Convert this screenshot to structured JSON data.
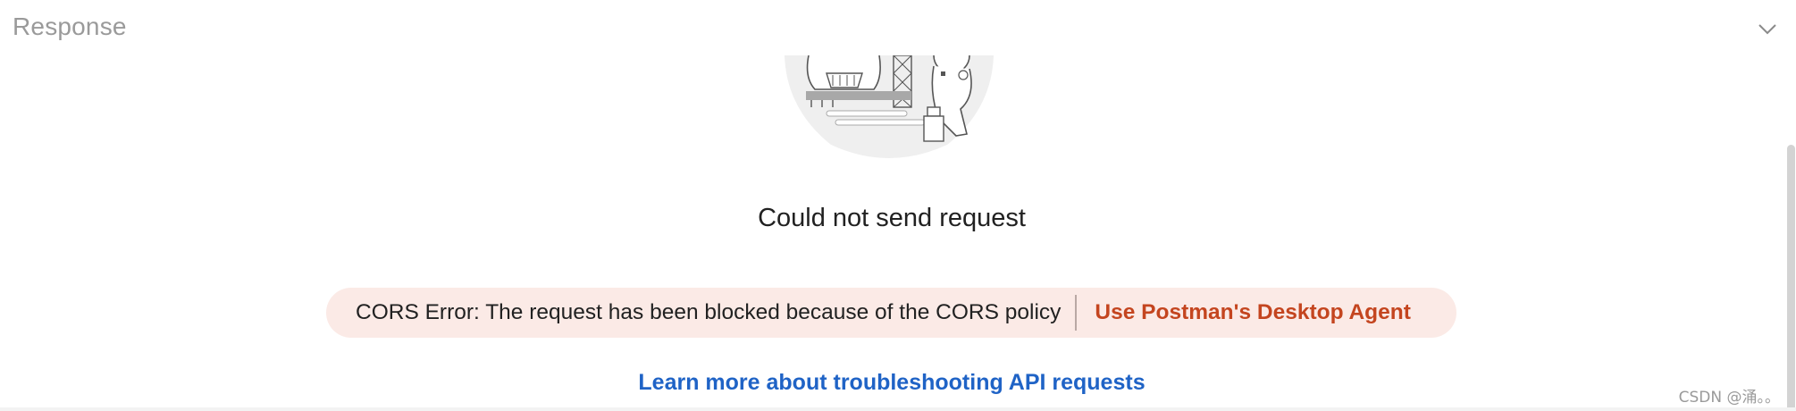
{
  "response": {
    "title": "Response",
    "collapse_icon": "chevron-down-icon"
  },
  "illustration": {
    "icon": "rocket-astronaut-illustration"
  },
  "error": {
    "message": "Could not send request",
    "cors_text": "CORS Error: The request has been blocked because of the CORS policy",
    "cors_link": "Use Postman's Desktop Agent",
    "learn_link": "Learn more about troubleshooting API requests"
  },
  "watermark": {
    "text": "CSDN @涌。。"
  },
  "colors": {
    "title_gray": "#9a9a9a",
    "pill_bg": "#fbeae6",
    "cors_link": "#c4451f",
    "learn_link": "#1f63c6"
  }
}
